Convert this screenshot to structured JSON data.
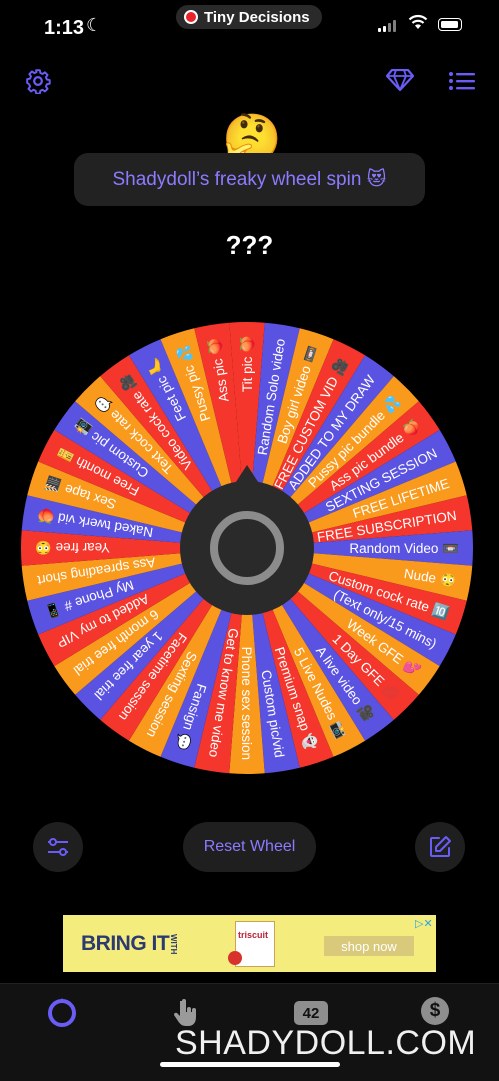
{
  "status": {
    "time": "1:13",
    "app_name": "Tiny Decisions"
  },
  "header": {
    "settings_icon": "gear-icon",
    "premium_icon": "diamond-icon",
    "list_icon": "list-icon",
    "emoji": "🤔",
    "title": "Shadydoll’s freaky wheel spin 😻",
    "result": "???"
  },
  "wheel": {
    "colors": [
      "#f5362c",
      "#5a52e0",
      "#fa9a1c"
    ],
    "segments": [
      "Tit pic 🍑",
      "Random Solo video",
      "Boy girl video 📼",
      "FREE CUSTOM VID 🎥",
      "ADDED TO MY DRAW",
      "Pussy pic bundle 💦",
      "Ass pic bundle 🍑",
      "SEXTING SESSION",
      "FREE LIFETIME",
      "FREE SUBSCRIPTION",
      "Random Video 📼",
      "Nude 😳",
      "Custom cock rate 🔟",
      "(Text only/15 mins)",
      "Week GFE 💕",
      "1 Day GFE 💋",
      "A live video 🎥",
      "5 Live Nudes 📸",
      "Premium snap 👻",
      "Custom pic/vid",
      "Phone sex session",
      "Get to know me video",
      "Fansign 💬",
      "Sexting session",
      "Facetime session",
      "1 year free trial",
      "6 month free trial",
      "Added to my VIP",
      "My Phone # 📱",
      "Ass spreading short",
      "Year free 😳",
      "Naked twerk vid 🍑",
      "Sex tape 🎬",
      "Free month 🎫",
      "Custom pic 📸",
      "Text cock rate 💬",
      "Video cock rate 🎥",
      "Feet pic 🦶",
      "Pussy pic 💦",
      "Ass pic 🍑"
    ]
  },
  "controls": {
    "reset_label": "Reset Wheel",
    "filter_icon": "sliders-icon",
    "edit_icon": "edit-icon"
  },
  "ad": {
    "headline": "BRING IT",
    "with": "WITH",
    "brand": "triscuit",
    "cta": "shop now",
    "corner": "▷✕"
  },
  "tabbar": {
    "items": [
      {
        "icon": "wheel-icon"
      },
      {
        "icon": "hand-tap-icon"
      },
      {
        "icon": "counter-icon",
        "label": "42"
      },
      {
        "icon": "dollar-icon",
        "label": "$"
      }
    ]
  },
  "watermark": "SHADYDOLL.COM"
}
